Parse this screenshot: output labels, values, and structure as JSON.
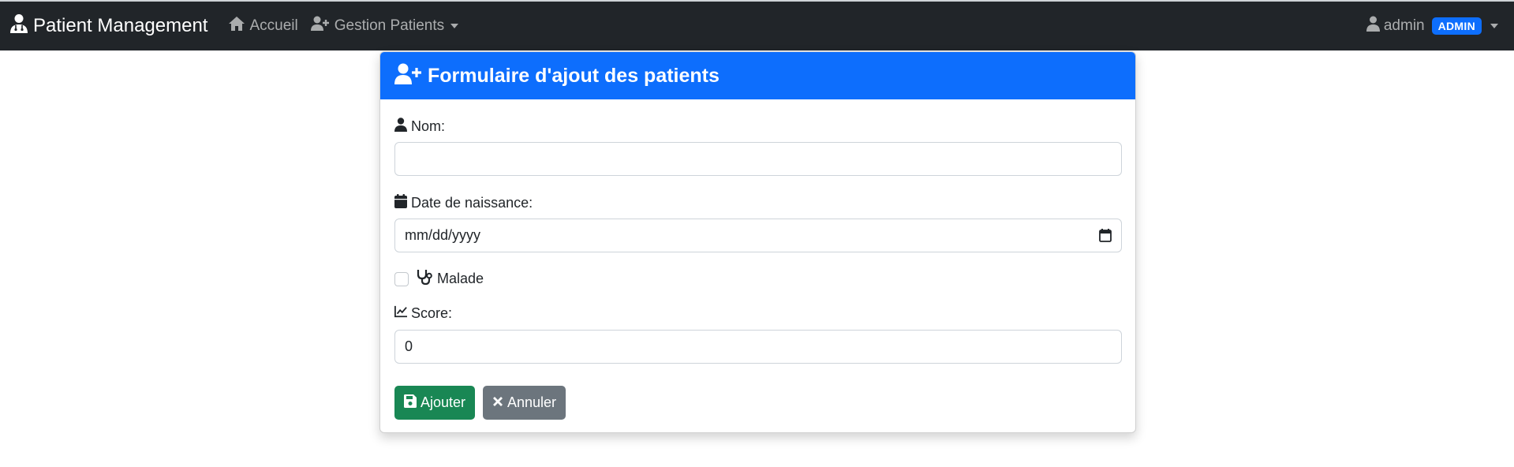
{
  "navbar": {
    "brand": "Patient Management",
    "home_label": "Accueil",
    "patients_label": "Gestion Patients",
    "user_name": "admin",
    "user_role_badge": "ADMIN"
  },
  "form": {
    "title": "Formulaire d'ajout des patients",
    "nom_label": "Nom:",
    "nom_value": "",
    "date_label": "Date de naissance:",
    "date_placeholder": "mm/dd/yyyy",
    "malade_label": "Malade",
    "malade_checked": false,
    "score_label": "Score:",
    "score_value": "0",
    "submit_label": "Ajouter",
    "cancel_label": "Annuler"
  },
  "colors": {
    "navbar_bg": "#212529",
    "card_header": "#0d6efd",
    "badge": "#0d6efd",
    "btn_save": "#198754",
    "btn_cancel": "#6c757d"
  },
  "icons": {
    "brand": "user-doctor-icon",
    "home": "home-icon",
    "patients": "user-plus-icon",
    "user": "user-icon",
    "header": "user-plus-icon",
    "nom": "user-icon",
    "date": "calendar-icon",
    "date_picker": "calendar-icon",
    "malade": "stethoscope-icon",
    "score": "chart-line-icon",
    "save": "save-icon",
    "cancel": "times-icon"
  }
}
